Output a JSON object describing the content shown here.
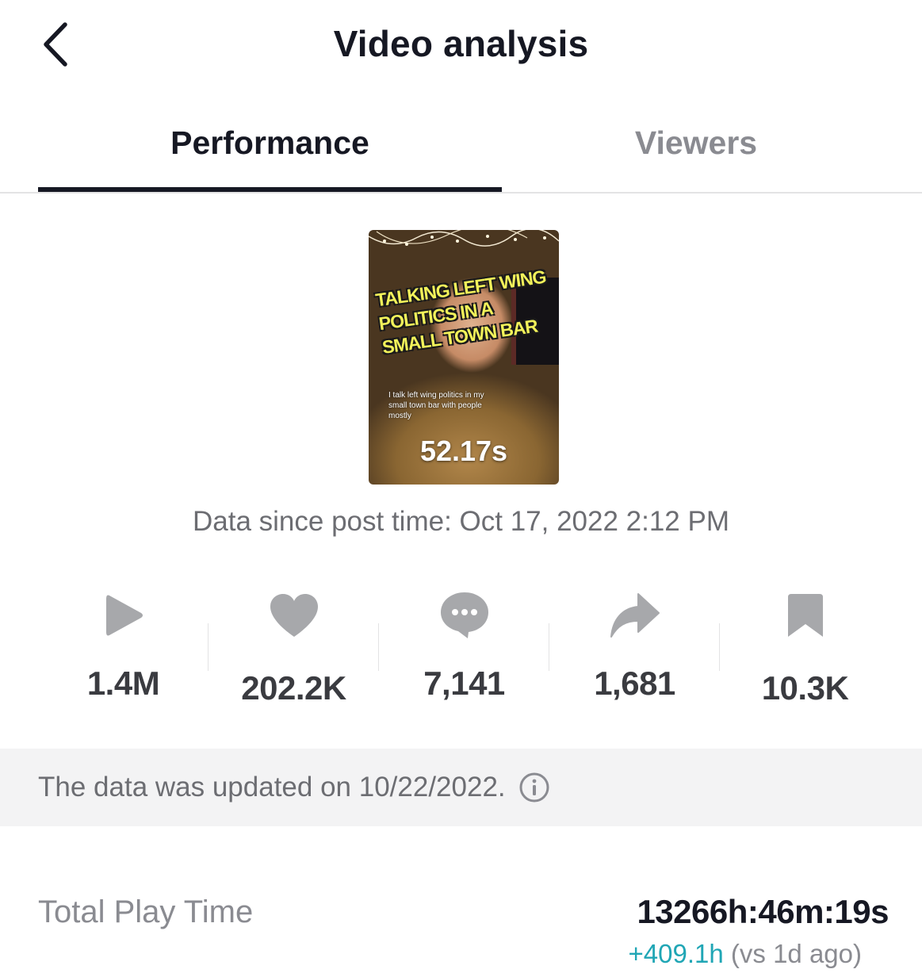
{
  "header": {
    "title": "Video analysis",
    "back_icon": "chevron-left-icon"
  },
  "tabs": [
    {
      "label": "Performance",
      "active": true
    },
    {
      "label": "Viewers",
      "active": false
    }
  ],
  "video": {
    "headline": "TALKING LEFT WING POLITICS IN A SMALL TOWN BAR",
    "caption": "I talk left wing politics in my small town bar with people mostly",
    "duration": "52.17s"
  },
  "post_time": "Data since post time: Oct 17, 2022 2:12 PM",
  "stats": [
    {
      "icon": "play-icon",
      "value": "1.4M"
    },
    {
      "icon": "heart-icon",
      "value": "202.2K"
    },
    {
      "icon": "comment-icon",
      "value": "7,141"
    },
    {
      "icon": "share-icon",
      "value": "1,681"
    },
    {
      "icon": "bookmark-icon",
      "value": "10.3K"
    }
  ],
  "update_banner": {
    "text": "The data was updated on 10/22/2022.",
    "icon": "info-icon"
  },
  "total_play_time": {
    "label": "Total Play Time",
    "value": "13266h:46m:19s",
    "delta": "+409.1h",
    "delta_note": "(vs 1d ago)"
  },
  "colors": {
    "text_primary": "#161823",
    "text_secondary": "#8a8b91",
    "icon_gray": "#a7a8ab",
    "accent_teal": "#20a6b5",
    "banner_bg": "#f3f3f4"
  }
}
